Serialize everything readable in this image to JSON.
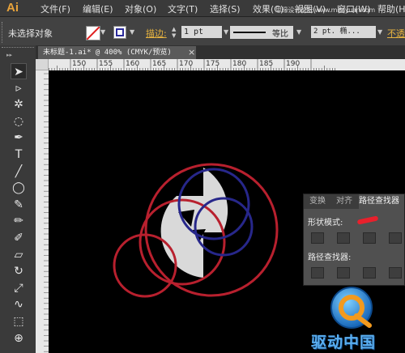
{
  "menubar": {
    "logo": "Ai",
    "items": [
      "文件(F)",
      "编辑(E)",
      "对象(O)",
      "文字(T)",
      "选择(S)",
      "效果(C)",
      "视图(V)",
      "窗口(W)",
      "帮助(H)"
    ]
  },
  "watermark_top": "思缘设计论坛 www.missyuan.com",
  "control": {
    "selection_status": "未选择对象",
    "stroke_label": "描边:",
    "stroke_weight": "1 pt",
    "profile_label": "等比",
    "brush_label": "2 pt. 椭...",
    "opacity_label": "不透"
  },
  "document_tab": {
    "title": "未标题-1.ai* @ 400% (CMYK/预览)",
    "close": "×"
  },
  "ruler": {
    "ticks": [
      "150",
      "155",
      "160",
      "165",
      "170",
      "175",
      "180",
      "185",
      "190"
    ]
  },
  "tools": [
    "selection-tool",
    "direct-selection-tool",
    "magic-wand-tool",
    "lasso-tool",
    "pen-tool",
    "type-tool",
    "line-tool",
    "ellipse-tool",
    "paintbrush-tool",
    "pencil-tool",
    "blob-brush-tool",
    "eraser-tool",
    "rotate-tool",
    "scale-tool",
    "warp-tool",
    "free-transform-tool",
    "shape-builder-tool"
  ],
  "pathfinder_panel": {
    "tabs": [
      "变换",
      "对齐",
      "路径查找器"
    ],
    "shape_modes_label": "形状模式:",
    "pathfinders_label": "路径查找器:"
  },
  "brand_watermark": "驱动中国",
  "colors": {
    "red_circle": "#b8202e",
    "blue_circle": "#27278a",
    "shape_fill": "#d9d9d9",
    "annotation_red": "#e8202c",
    "logo_orange": "#e8a33a"
  }
}
